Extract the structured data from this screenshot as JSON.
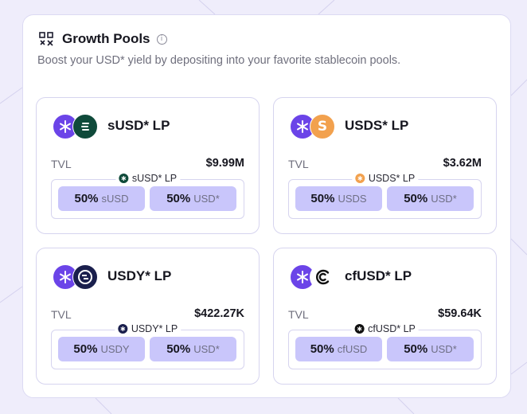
{
  "header": {
    "title": "Growth Pools",
    "subtitle": "Boost your USD* yield by depositing into your favorite stablecoin pools."
  },
  "pools": [
    {
      "title": "sUSD* LP",
      "tvl_label": "TVL",
      "tvl": "$9.99M",
      "pool_label": "sUSD* LP",
      "left": {
        "pct": "50%",
        "token": "sUSD"
      },
      "right": {
        "pct": "50%",
        "token": "USD*"
      },
      "icon": "susd-icon",
      "color": "#0f4a3a"
    },
    {
      "title": "USDS* LP",
      "tvl_label": "TVL",
      "tvl": "$3.62M",
      "pool_label": "USDS* LP",
      "left": {
        "pct": "50%",
        "token": "USDS"
      },
      "right": {
        "pct": "50%",
        "token": "USD*"
      },
      "icon": "usds-icon",
      "color": "#f2a14e"
    },
    {
      "title": "USDY* LP",
      "tvl_label": "TVL",
      "tvl": "$422.27K",
      "pool_label": "USDY* LP",
      "left": {
        "pct": "50%",
        "token": "USDY"
      },
      "right": {
        "pct": "50%",
        "token": "USD*"
      },
      "icon": "usdy-icon",
      "color": "#1a1f4d"
    },
    {
      "title": "cfUSD* LP",
      "tvl_label": "TVL",
      "tvl": "$59.64K",
      "pool_label": "cfUSD* LP",
      "left": {
        "pct": "50%",
        "token": "cfUSD"
      },
      "right": {
        "pct": "50%",
        "token": "USD*"
      },
      "icon": "cfusd-icon",
      "color": "#111111"
    }
  ],
  "colors": {
    "accent": "#6b44e8",
    "pill": "#c9c6fb",
    "background": "#efedfb"
  }
}
